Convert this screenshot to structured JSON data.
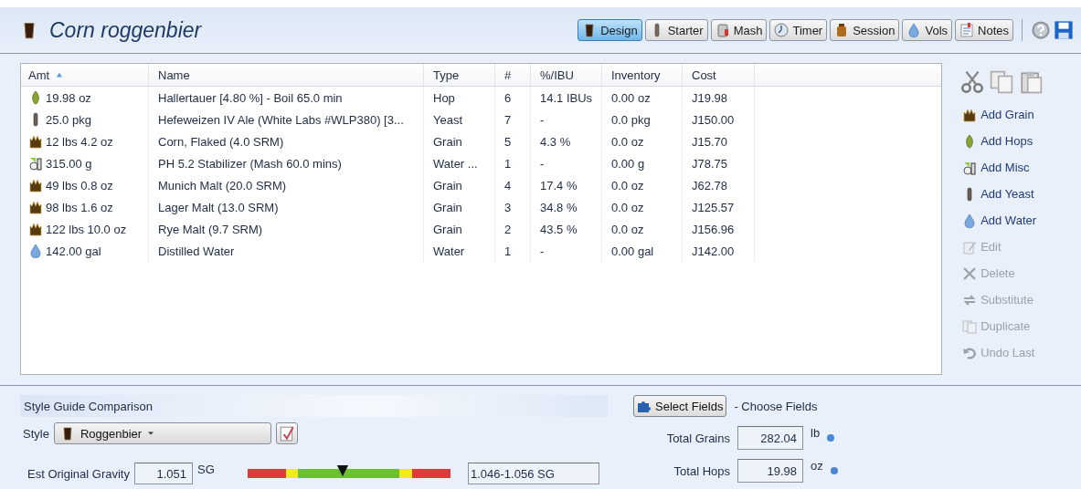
{
  "recipe": {
    "title": "Corn roggenbier"
  },
  "toolbar": {
    "tabs": [
      {
        "label": "Design",
        "selected": true
      },
      {
        "label": "Starter",
        "selected": false
      },
      {
        "label": "Mash",
        "selected": false
      },
      {
        "label": "Timer",
        "selected": false
      },
      {
        "label": "Session",
        "selected": false
      },
      {
        "label": "Vols",
        "selected": false
      },
      {
        "label": "Notes",
        "selected": false
      }
    ]
  },
  "table": {
    "columns": [
      {
        "label": "Amt",
        "sorted": true
      },
      {
        "label": "Name",
        "sorted": false
      },
      {
        "label": "Type",
        "sorted": false
      },
      {
        "label": "#",
        "sorted": false
      },
      {
        "label": "%/IBU",
        "sorted": false
      },
      {
        "label": "Inventory",
        "sorted": false
      },
      {
        "label": "Cost",
        "sorted": false
      }
    ],
    "rows": [
      {
        "kind": "hop",
        "cells": [
          "19.98 oz",
          "Hallertauer [4.80 %] - Boil 65.0 min",
          "Hop",
          "6",
          "14.1 IBUs",
          "0.00 oz",
          "J19.98"
        ]
      },
      {
        "kind": "yeast",
        "cells": [
          "25.0 pkg",
          "Hefeweizen IV Ale (White Labs #WLP380) [3...",
          "Yeast",
          "7",
          "-",
          "0.0 pkg",
          "J150.00"
        ]
      },
      {
        "kind": "grain",
        "cells": [
          "12 lbs 4.2 oz",
          "Corn, Flaked (4.0 SRM)",
          "Grain",
          "5",
          "4.3 %",
          "0.0 oz",
          "J15.70"
        ]
      },
      {
        "kind": "misc",
        "cells": [
          "315.00 g",
          "PH 5.2 Stabilizer (Mash 60.0 mins)",
          "Water ...",
          "1",
          "-",
          "0.00 g",
          "J78.75"
        ]
      },
      {
        "kind": "grain",
        "cells": [
          "49 lbs 0.8 oz",
          "Munich Malt (20.0 SRM)",
          "Grain",
          "4",
          "17.4 %",
          "0.0 oz",
          "J62.78"
        ]
      },
      {
        "kind": "grain",
        "cells": [
          "98 lbs 1.6 oz",
          "Lager Malt (13.0 SRM)",
          "Grain",
          "3",
          "34.8 %",
          "0.0 oz",
          "J125.57"
        ]
      },
      {
        "kind": "grain",
        "cells": [
          "122 lbs 10.0 oz",
          "Rye Malt (9.7 SRM)",
          "Grain",
          "2",
          "43.5 %",
          "0.0 oz",
          "J156.96"
        ]
      },
      {
        "kind": "water",
        "cells": [
          "142.00 gal",
          "Distilled Water",
          "Water",
          "1",
          "-",
          "0.00 gal",
          "J142.00"
        ]
      }
    ]
  },
  "actions": [
    {
      "label": "Add Grain",
      "disabled": false
    },
    {
      "label": "Add Hops",
      "disabled": false
    },
    {
      "label": "Add Misc",
      "disabled": false
    },
    {
      "label": "Add Yeast",
      "disabled": false
    },
    {
      "label": "Add Water",
      "disabled": false
    },
    {
      "label": "Edit",
      "disabled": true
    },
    {
      "label": "Delete",
      "disabled": true
    },
    {
      "label": "Substitute",
      "disabled": true
    },
    {
      "label": "Duplicate",
      "disabled": true
    },
    {
      "label": "Undo Last",
      "disabled": true
    }
  ],
  "style_guide": {
    "title": "Style Guide Comparison",
    "style_label": "Style",
    "style_value": "Roggenbier",
    "og": {
      "label": "Est Original Gravity",
      "value": "1.051",
      "unit": "SG",
      "level": 0.47,
      "range": "1.046-1.056 SG"
    }
  },
  "fields": {
    "button": "Select Fields",
    "hint": "- Choose Fields",
    "items": [
      {
        "label": "Total Grains",
        "value": "282.04",
        "unit": "lb"
      },
      {
        "label": "Total Hops",
        "value": "19.98",
        "unit": "oz"
      }
    ]
  }
}
